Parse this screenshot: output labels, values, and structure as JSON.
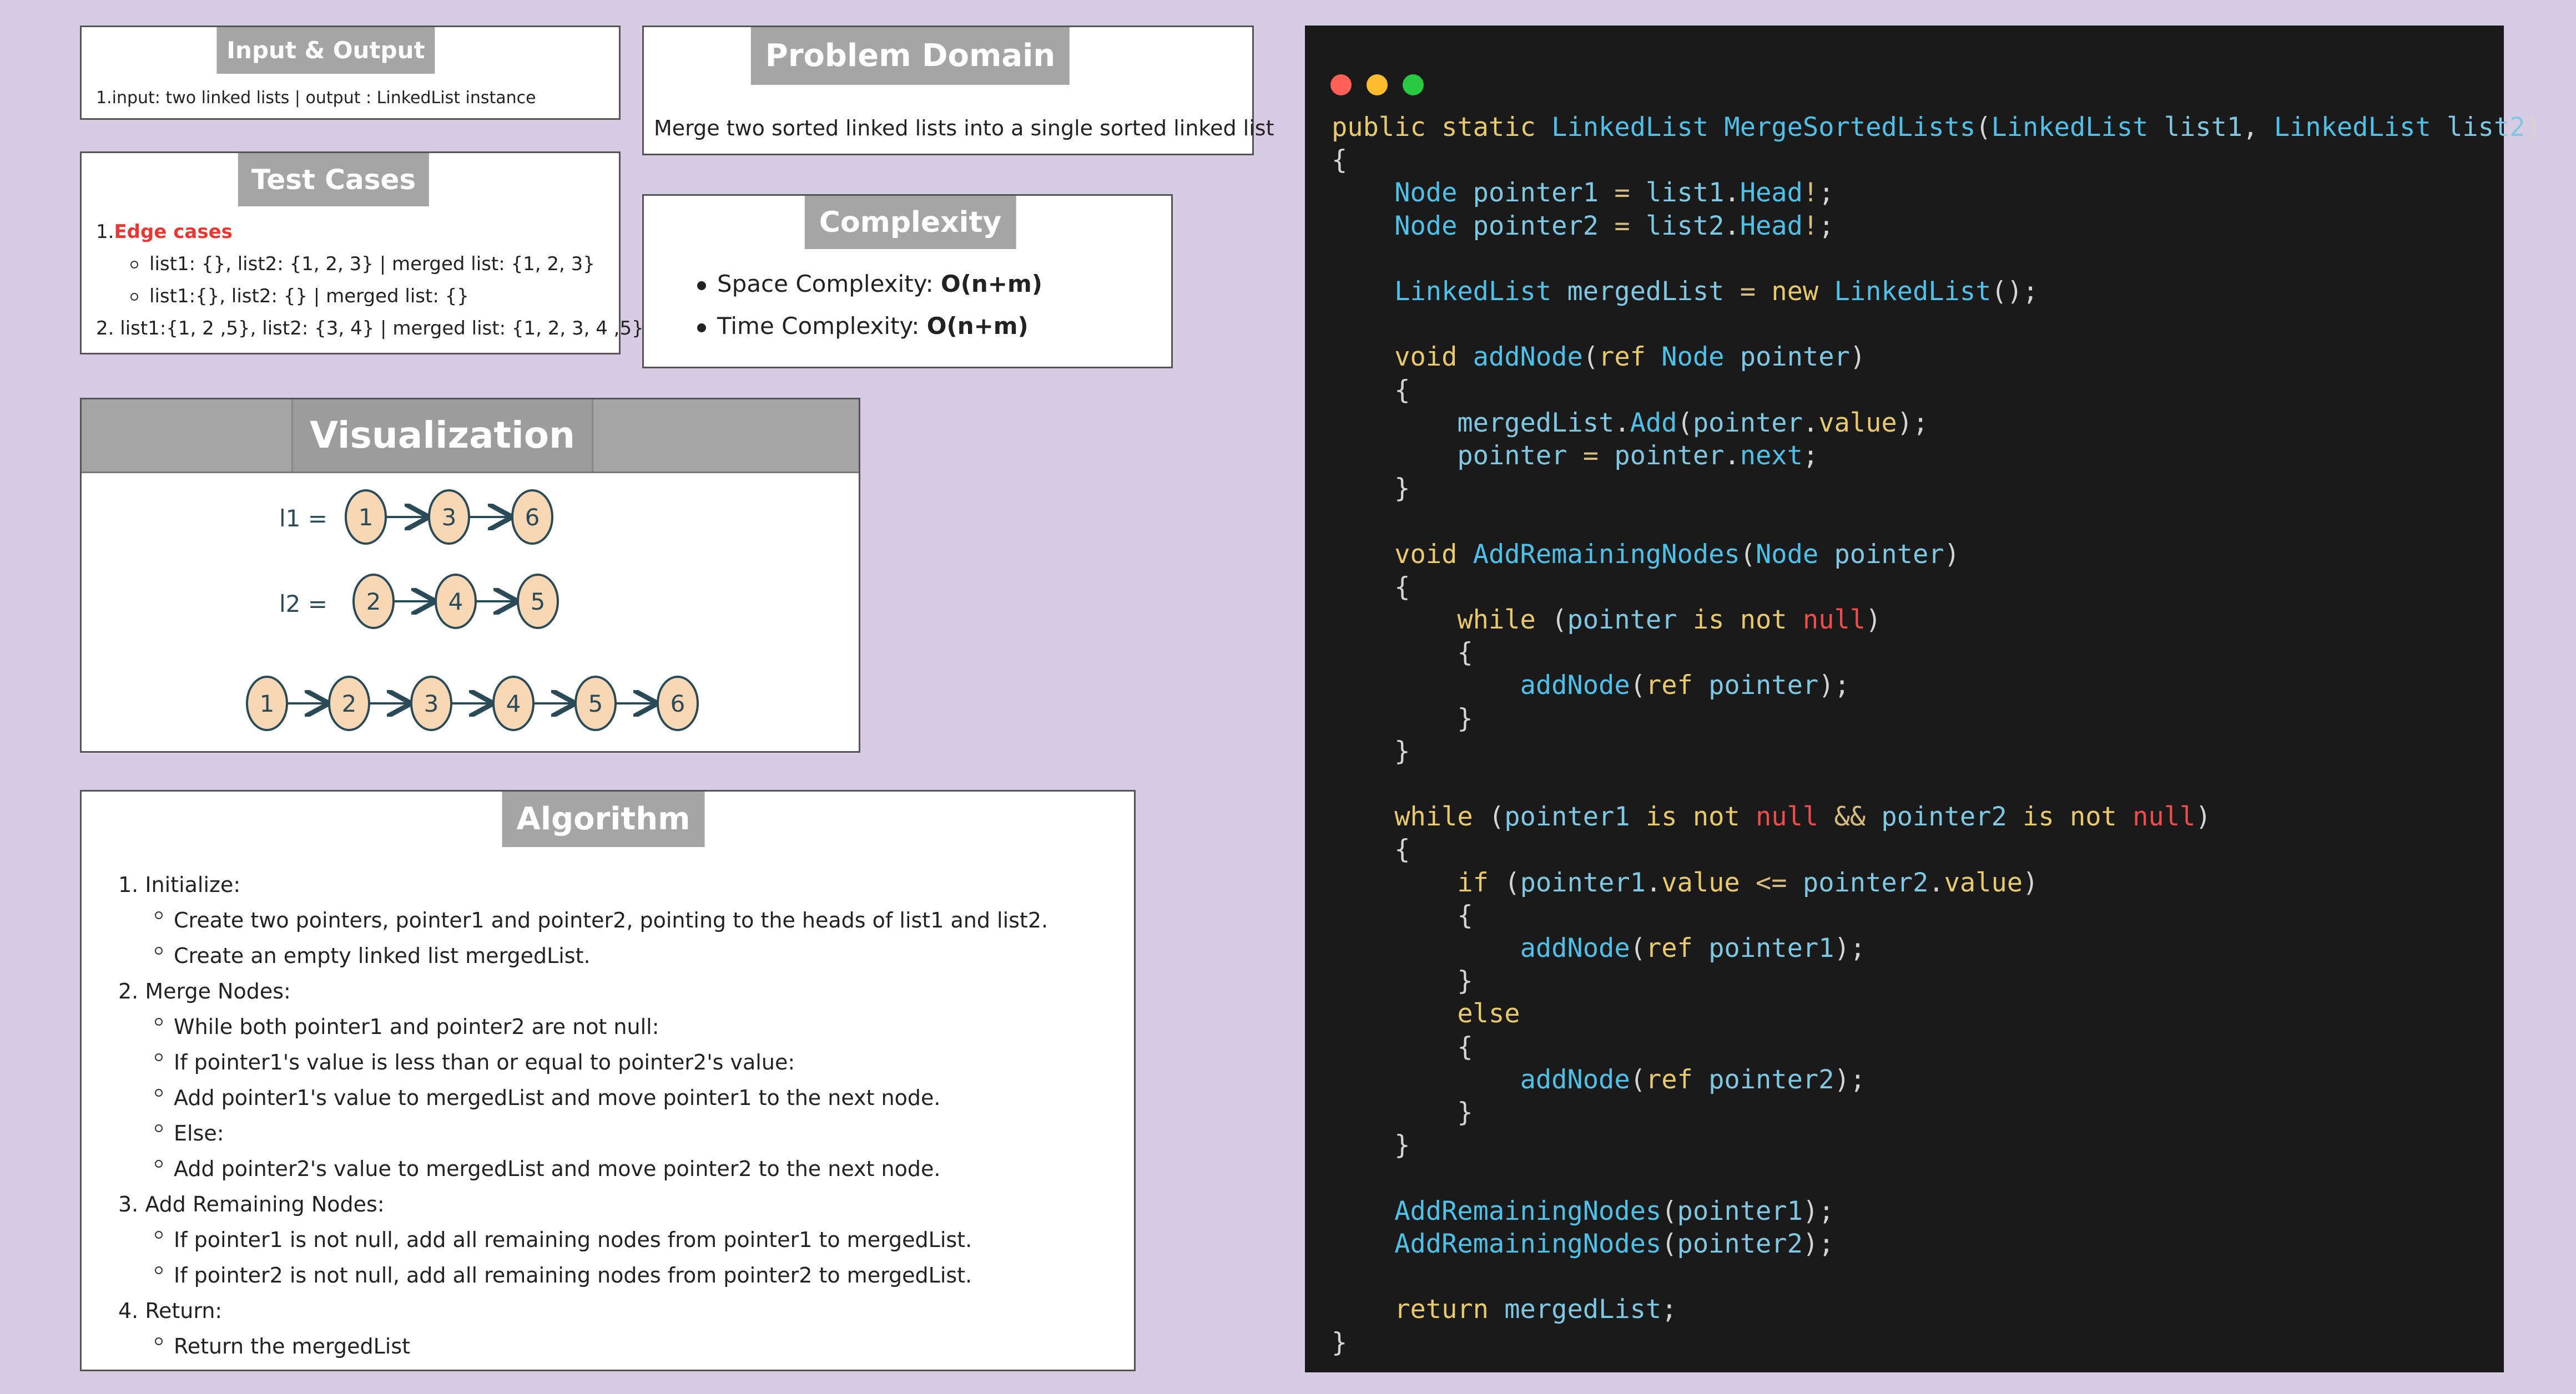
{
  "io": {
    "title": "Input & Output",
    "line": "1.input: two linked lists | output : LinkedList instance"
  },
  "problem": {
    "title": "Problem Domain",
    "text": "Merge two sorted linked lists into a single sorted linked list"
  },
  "tests": {
    "title": "Test Cases",
    "num1": "1.",
    "edge": "Edge cases",
    "sub1": "list1: {}, list2: {1, 2, 3} | merged list: {1, 2, 3}",
    "sub2": "list1:{}, list2: {} | merged list: {}",
    "line2": "2. list1:{1, 2 ,5}, list2: {3, 4} | merged list: {1, 2, 3, 4 ,5}",
    "edge_color": "#e53935"
  },
  "complexity": {
    "title": "Complexity",
    "space_label": "Space Complexity: ",
    "space_value": "O(n+m)",
    "time_label": "Time Complexity: ",
    "time_value": "O(n+m)"
  },
  "visualization": {
    "title": "Visualization",
    "l1_label": "l1 =",
    "l2_label": "l2 =",
    "l1": [
      "1",
      "3",
      "6"
    ],
    "l2": [
      "2",
      "4",
      "5"
    ],
    "merged": [
      "1",
      "2",
      "3",
      "4",
      "5",
      "6"
    ],
    "node_fill": "#f8d7b4",
    "ink": "#2a4a58"
  },
  "algorithm": {
    "title": "Algorithm",
    "s1": "1. Initialize:",
    "s1a": "Create two pointers, pointer1 and pointer2, pointing to the heads of list1 and list2.",
    "s1b": "Create an empty linked list mergedList.",
    "s2": "2. Merge Nodes:",
    "s2a": "While both pointer1 and pointer2 are not null:",
    "s2b": "If pointer1's value is less than or equal to pointer2's value:",
    "s2c": "Add pointer1's value to mergedList and move pointer1 to the next node.",
    "s2d": "Else:",
    "s2e": "Add pointer2's value to mergedList and move pointer2 to the next node.",
    "s3": "3. Add Remaining Nodes:",
    "s3a": "If pointer1 is not null, add all remaining nodes from pointer1 to mergedList.",
    "s3b": "If pointer2 is not null, add all remaining nodes from pointer2 to mergedList.",
    "s4": "4. Return:",
    "s4a": "Return the mergedList"
  },
  "code": {
    "window_dots": [
      "#ff5f57",
      "#febc2e",
      "#28c840"
    ],
    "c01": "public",
    "c02": "static",
    "c03": "LinkedList",
    "c04": "MergeSortedLists",
    "c05": "LinkedList",
    "c06": "list1",
    "c07": "LinkedList",
    "c08": "list2",
    "c09": "Node",
    "c10": "pointer1",
    "c11": "list1",
    "c12": "Head",
    "c13": "Node",
    "c14": "pointer2",
    "c15": "list2",
    "c16": "Head",
    "c17": "LinkedList",
    "c18": "mergedList",
    "c19": "new",
    "c20": "LinkedList",
    "c21": "void",
    "c22": "addNode",
    "c23": "ref",
    "c24": "Node",
    "c25": "pointer",
    "c26": "mergedList",
    "c27": "Add",
    "c28": "pointer",
    "c29": "value",
    "c30": "pointer",
    "c31": "pointer",
    "c32": "next",
    "c33": "void",
    "c34": "AddRemainingNodes",
    "c35": "Node",
    "c36": "pointer",
    "c37": "while",
    "c38": "pointer",
    "c39": "is",
    "c40": "not",
    "c41": "null",
    "c42": "addNode",
    "c43": "ref",
    "c44": "pointer",
    "c45": "while",
    "c46": "pointer1",
    "c47": "is",
    "c48": "not",
    "c49": "null",
    "c50": "pointer2",
    "c51": "is",
    "c52": "not",
    "c53": "null",
    "c54": "if",
    "c55": "pointer1",
    "c56": "value",
    "c57": "pointer2",
    "c58": "value",
    "c59": "addNode",
    "c60": "ref",
    "c61": "pointer1",
    "c62": "else",
    "c63": "addNode",
    "c64": "ref",
    "c65": "pointer2",
    "c66": "AddRemainingNodes",
    "c67": "pointer1",
    "c68": "AddRemainingNodes",
    "c69": "pointer2",
    "c70": "return",
    "c71": "mergedList"
  }
}
